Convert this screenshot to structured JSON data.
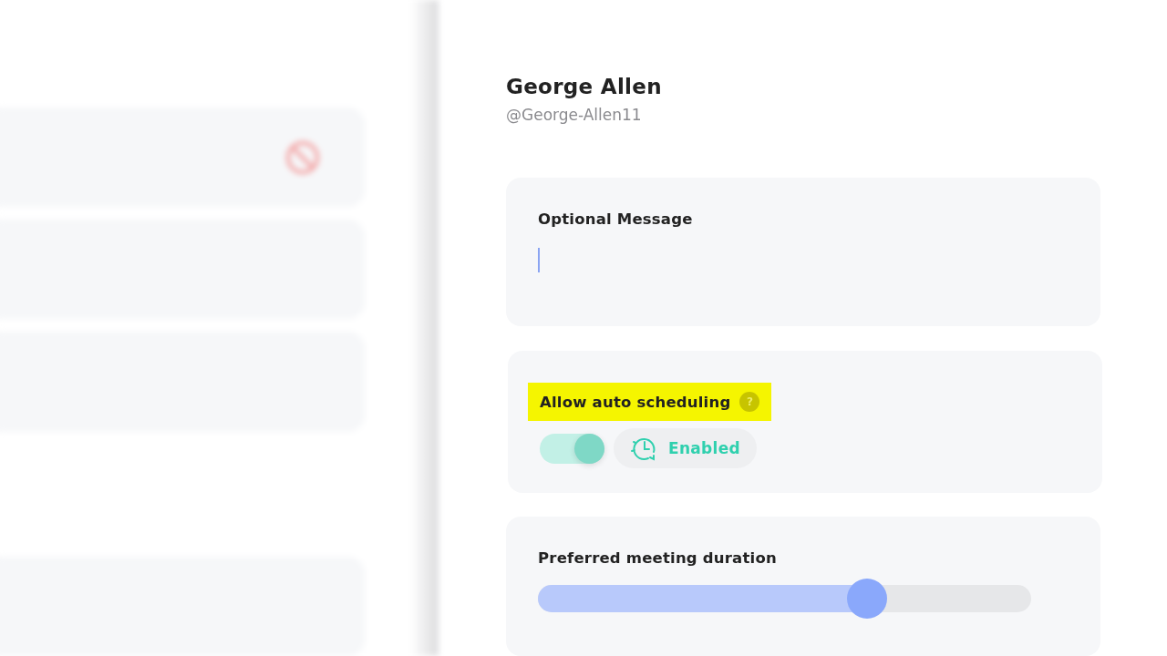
{
  "profile": {
    "name": "George Allen",
    "handle": "@George-Allen11"
  },
  "message": {
    "label": "Optional Message"
  },
  "auto_scheduling": {
    "label": "Allow auto scheduling",
    "help": "?",
    "highlighted": true,
    "on": true,
    "status": "Enabled"
  },
  "duration": {
    "label": "Preferred meeting duration",
    "level": 0.667
  }
}
